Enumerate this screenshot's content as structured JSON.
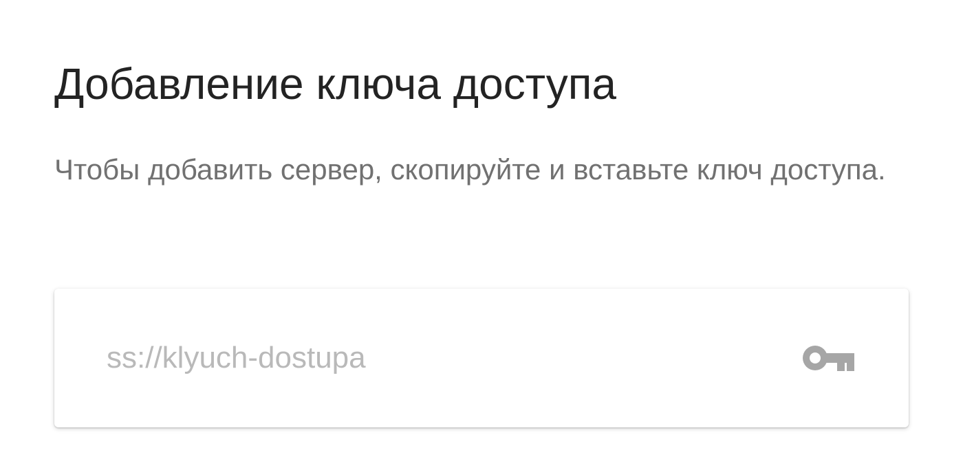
{
  "dialog": {
    "title": "Добавление ключа доступа",
    "description": "Чтобы добавить сервер, скопируйте и вставьте ключ доступа.",
    "access_key_input": {
      "value": "",
      "placeholder": "ss://klyuch-dostupa"
    },
    "key_icon": "key-icon"
  },
  "colors": {
    "background": "#ffffff",
    "title_text": "#232323",
    "description_text": "#717171",
    "placeholder_text": "#b9b9b9",
    "icon": "#a6a6a6"
  }
}
